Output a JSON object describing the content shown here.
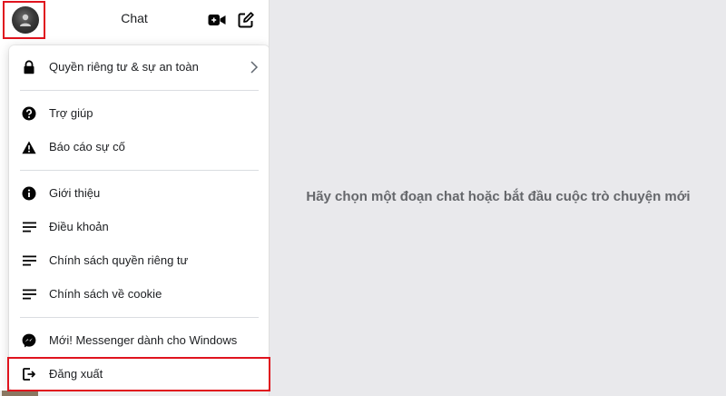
{
  "header": {
    "title": "Chat",
    "avatar_icon": "profile-avatar",
    "video_icon": "video-camera-icon",
    "compose_icon": "compose-icon"
  },
  "menu": {
    "items": [
      {
        "label": "Quyền riêng tư & sự an toàn",
        "icon": "lock-icon",
        "has_chevron": true
      },
      {
        "label": "Trợ giúp",
        "icon": "help-icon"
      },
      {
        "label": "Báo cáo sự cố",
        "icon": "warning-icon"
      },
      {
        "label": "Giới thiệu",
        "icon": "info-icon"
      },
      {
        "label": "Điều khoản",
        "icon": "lines-icon"
      },
      {
        "label": "Chính sách quyền riêng tư",
        "icon": "lines-icon"
      },
      {
        "label": "Chính sách về cookie",
        "icon": "lines-icon"
      },
      {
        "label": "Mới! Messenger dành cho Windows",
        "icon": "messenger-icon"
      },
      {
        "label": "Đăng xuất",
        "icon": "logout-icon"
      }
    ]
  },
  "main": {
    "empty_message": "Hãy chọn một đoạn chat hoặc bắt đầu cuộc trò chuyện mới"
  },
  "colors": {
    "highlight": "#e0141e",
    "background": "#e9e9ec",
    "text_muted": "#65676b"
  }
}
